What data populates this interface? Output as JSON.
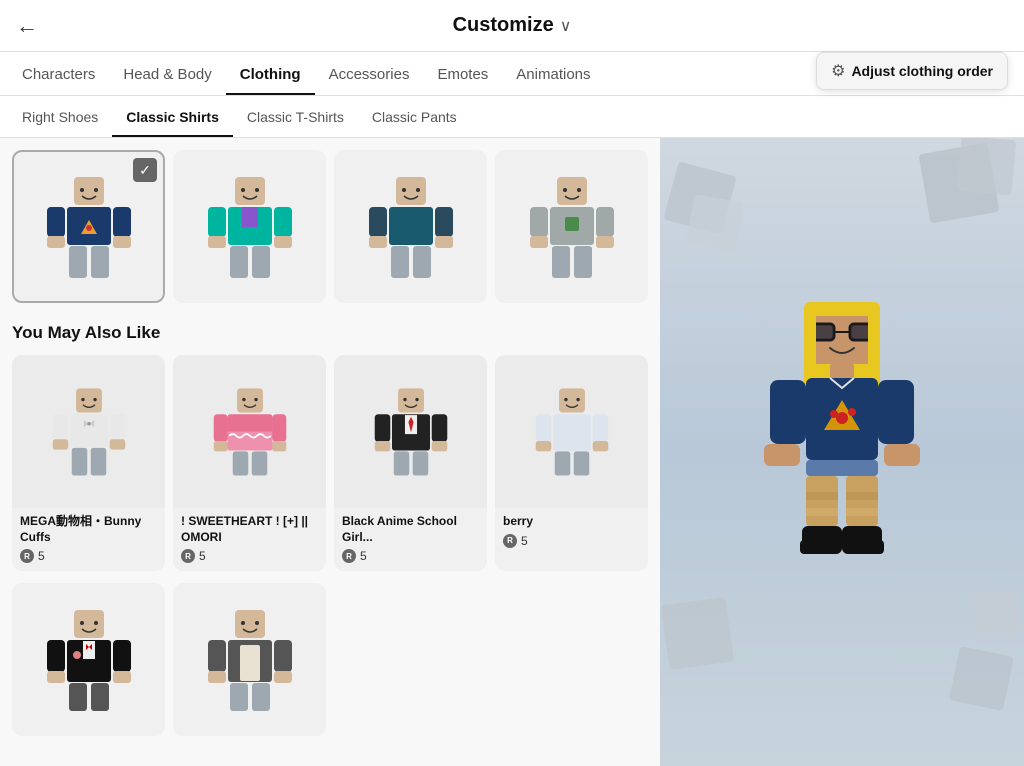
{
  "header": {
    "back_label": "←",
    "title": "Customize",
    "chevron": "∨"
  },
  "nav_tabs": [
    {
      "label": "Characters",
      "active": false
    },
    {
      "label": "Head & Body",
      "active": false
    },
    {
      "label": "Clothing",
      "active": true
    },
    {
      "label": "Accessories",
      "active": false
    },
    {
      "label": "Emotes",
      "active": false
    },
    {
      "label": "Animations",
      "active": false
    }
  ],
  "sub_tabs": [
    {
      "label": "Right Shoes",
      "active": false
    },
    {
      "label": "Classic Shirts",
      "active": true
    },
    {
      "label": "Classic T-Shirts",
      "active": false
    },
    {
      "label": "Classic Pants",
      "active": false
    }
  ],
  "adjust_btn": {
    "label": "Adjust clothing order",
    "icon": "sliders"
  },
  "top_items": [
    {
      "id": 1,
      "selected": true
    },
    {
      "id": 2,
      "selected": false
    },
    {
      "id": 3,
      "selected": false
    },
    {
      "id": 4,
      "selected": false
    }
  ],
  "suggestions_section": {
    "title": "You May Also Like"
  },
  "suggestions": [
    {
      "name": "MEGA動物相・Bunny Cuffs",
      "price": "5"
    },
    {
      "name": "! SWEETHEART ! [+] || OMORI",
      "price": "5"
    },
    {
      "name": "Black Anime School Girl...",
      "price": "5"
    },
    {
      "name": "berry",
      "price": "5"
    }
  ],
  "more_items": [
    {
      "id": 1
    },
    {
      "id": 2
    }
  ]
}
